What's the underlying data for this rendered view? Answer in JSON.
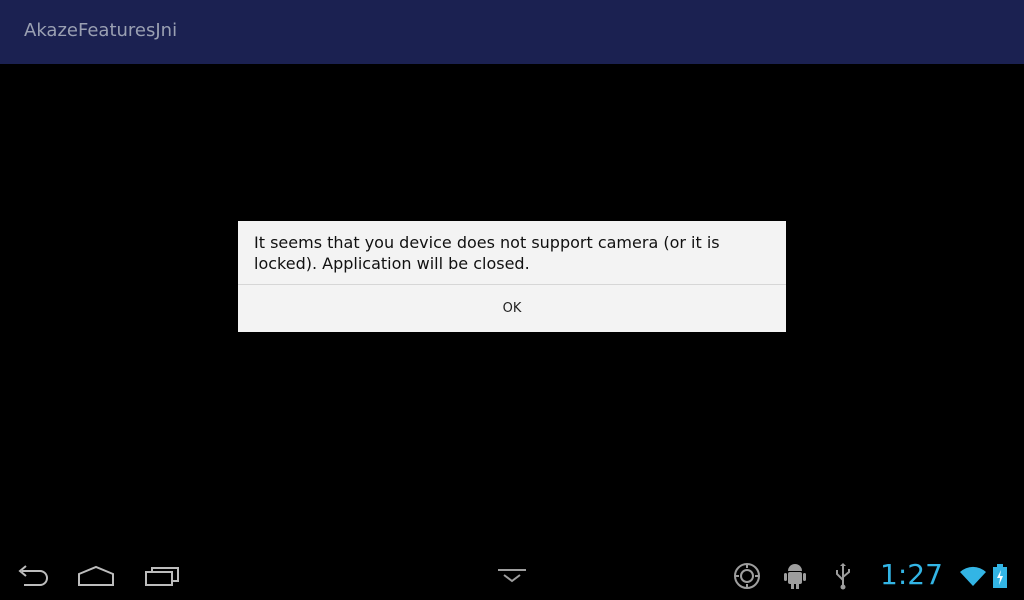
{
  "app": {
    "title": "AkazeFeaturesJni"
  },
  "dialog": {
    "message": "It seems that you device does not support camera (or it is locked). Application will be closed.",
    "ok_label": "OK"
  },
  "system_bar": {
    "clock": "1:27",
    "nav": {
      "back_icon": "back-icon",
      "home_icon": "home-icon",
      "recents_icon": "recent-apps-icon",
      "hide_keyboard_icon": "chevron-down-icon"
    },
    "status_icons": [
      "camera-notification-icon",
      "android-debug-icon",
      "usb-icon",
      "wifi-icon",
      "battery-charging-icon"
    ]
  },
  "colors": {
    "action_bar": "#1b2151",
    "clock": "#33b5e5",
    "background": "#000000",
    "dialog_bg": "#f3f3f3"
  }
}
